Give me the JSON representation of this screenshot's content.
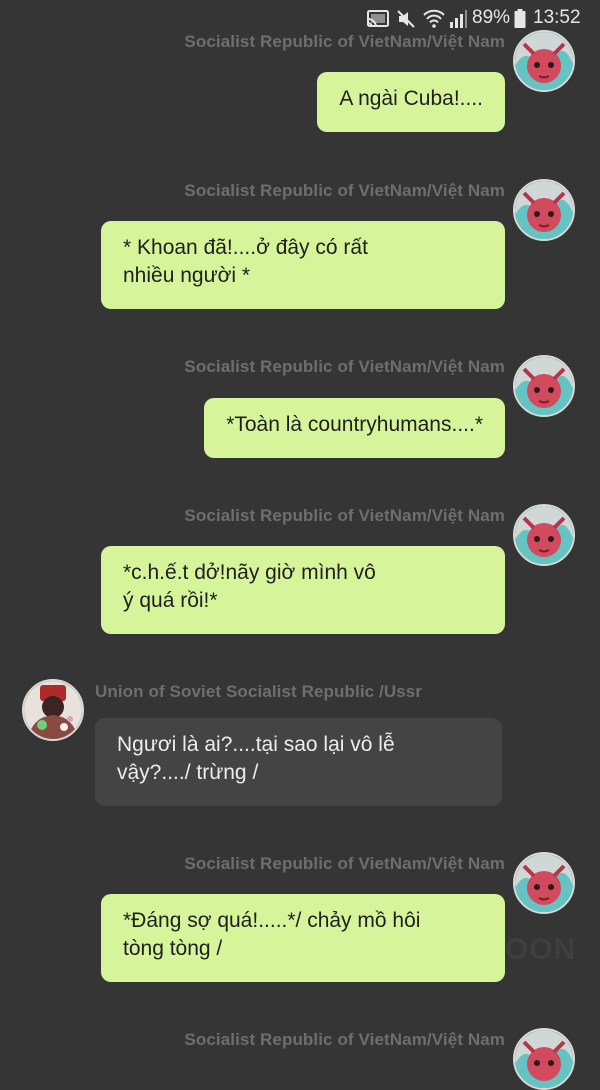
{
  "status_bar": {
    "battery": "89%",
    "time": "13:52",
    "icons": [
      "cast-icon",
      "mute-icon",
      "wifi-icon",
      "signal-icon",
      "battery-icon"
    ]
  },
  "messages": [
    {
      "sender": "Socialist Republic of VietNam/Việt  Nam",
      "side": "right",
      "text": "A ngài Cuba!...."
    },
    {
      "sender": "Socialist Republic of VietNam/Việt  Nam",
      "side": "right",
      "text_lines": [
        "* Khoan đã!....ở đây có rất",
        "nhiều người *"
      ]
    },
    {
      "sender": "Socialist Republic of VietNam/Việt  Nam",
      "side": "right",
      "text": "*Toàn là countryhumans....*"
    },
    {
      "sender": "Socialist Republic of VietNam/Việt  Nam",
      "side": "right",
      "text_lines": [
        "*c.h.ế.t dở!nãy giờ mình vô",
        "ý quá rồi!*"
      ]
    },
    {
      "sender": "Union of Soviet Socialist Republic /Ussr",
      "side": "left",
      "text_lines": [
        "Ngươi là ai?....tại sao lại vô lễ",
        "vậy?..../ trừng /"
      ]
    },
    {
      "sender": "Socialist Republic of VietNam/Việt  Nam",
      "side": "right",
      "text_lines": [
        "*Đáng sợ quá!.....*/ chảy mồ hôi",
        "tòng tòng /"
      ]
    },
    {
      "sender": "Socialist Republic of VietNam/Việt  Nam",
      "side": "right"
    }
  ],
  "watermark": "OON",
  "colors": {
    "background": "#353535",
    "bubble_right": "#d6f59b",
    "bubble_left": "#444444",
    "sender_text": "#6e6e6e"
  }
}
